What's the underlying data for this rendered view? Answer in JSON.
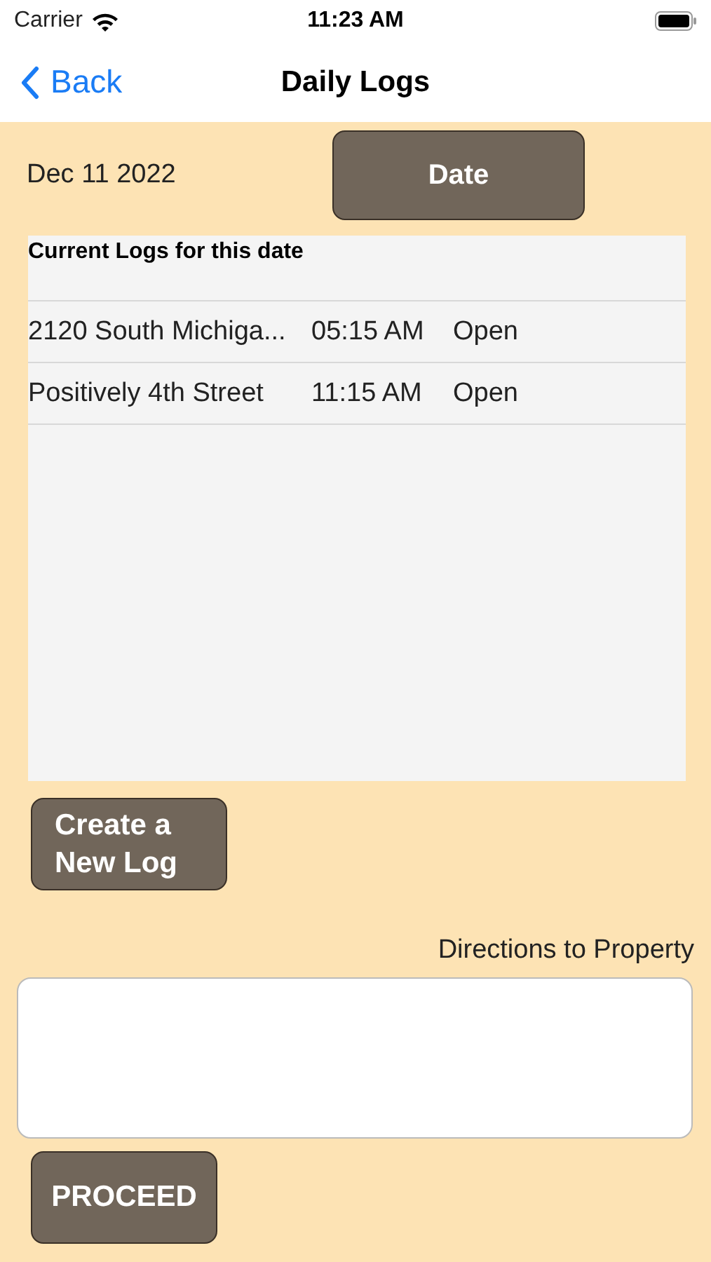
{
  "status_bar": {
    "carrier": "Carrier",
    "time": "11:23 AM"
  },
  "nav": {
    "back": "Back",
    "title": "Daily Logs"
  },
  "date": {
    "value": "Dec 11 2022",
    "button": "Date"
  },
  "logs": {
    "header": "Current Logs for this date",
    "rows": [
      {
        "name": "2120 South Michiga...",
        "time": "05:15 AM",
        "status": "Open"
      },
      {
        "name": "Positively 4th Street",
        "time": "11:15 AM",
        "status": "Open"
      }
    ]
  },
  "create_button": "Create a New Log",
  "directions": {
    "label": "Directions to Property"
  },
  "proceed_button": "PROCEED"
}
